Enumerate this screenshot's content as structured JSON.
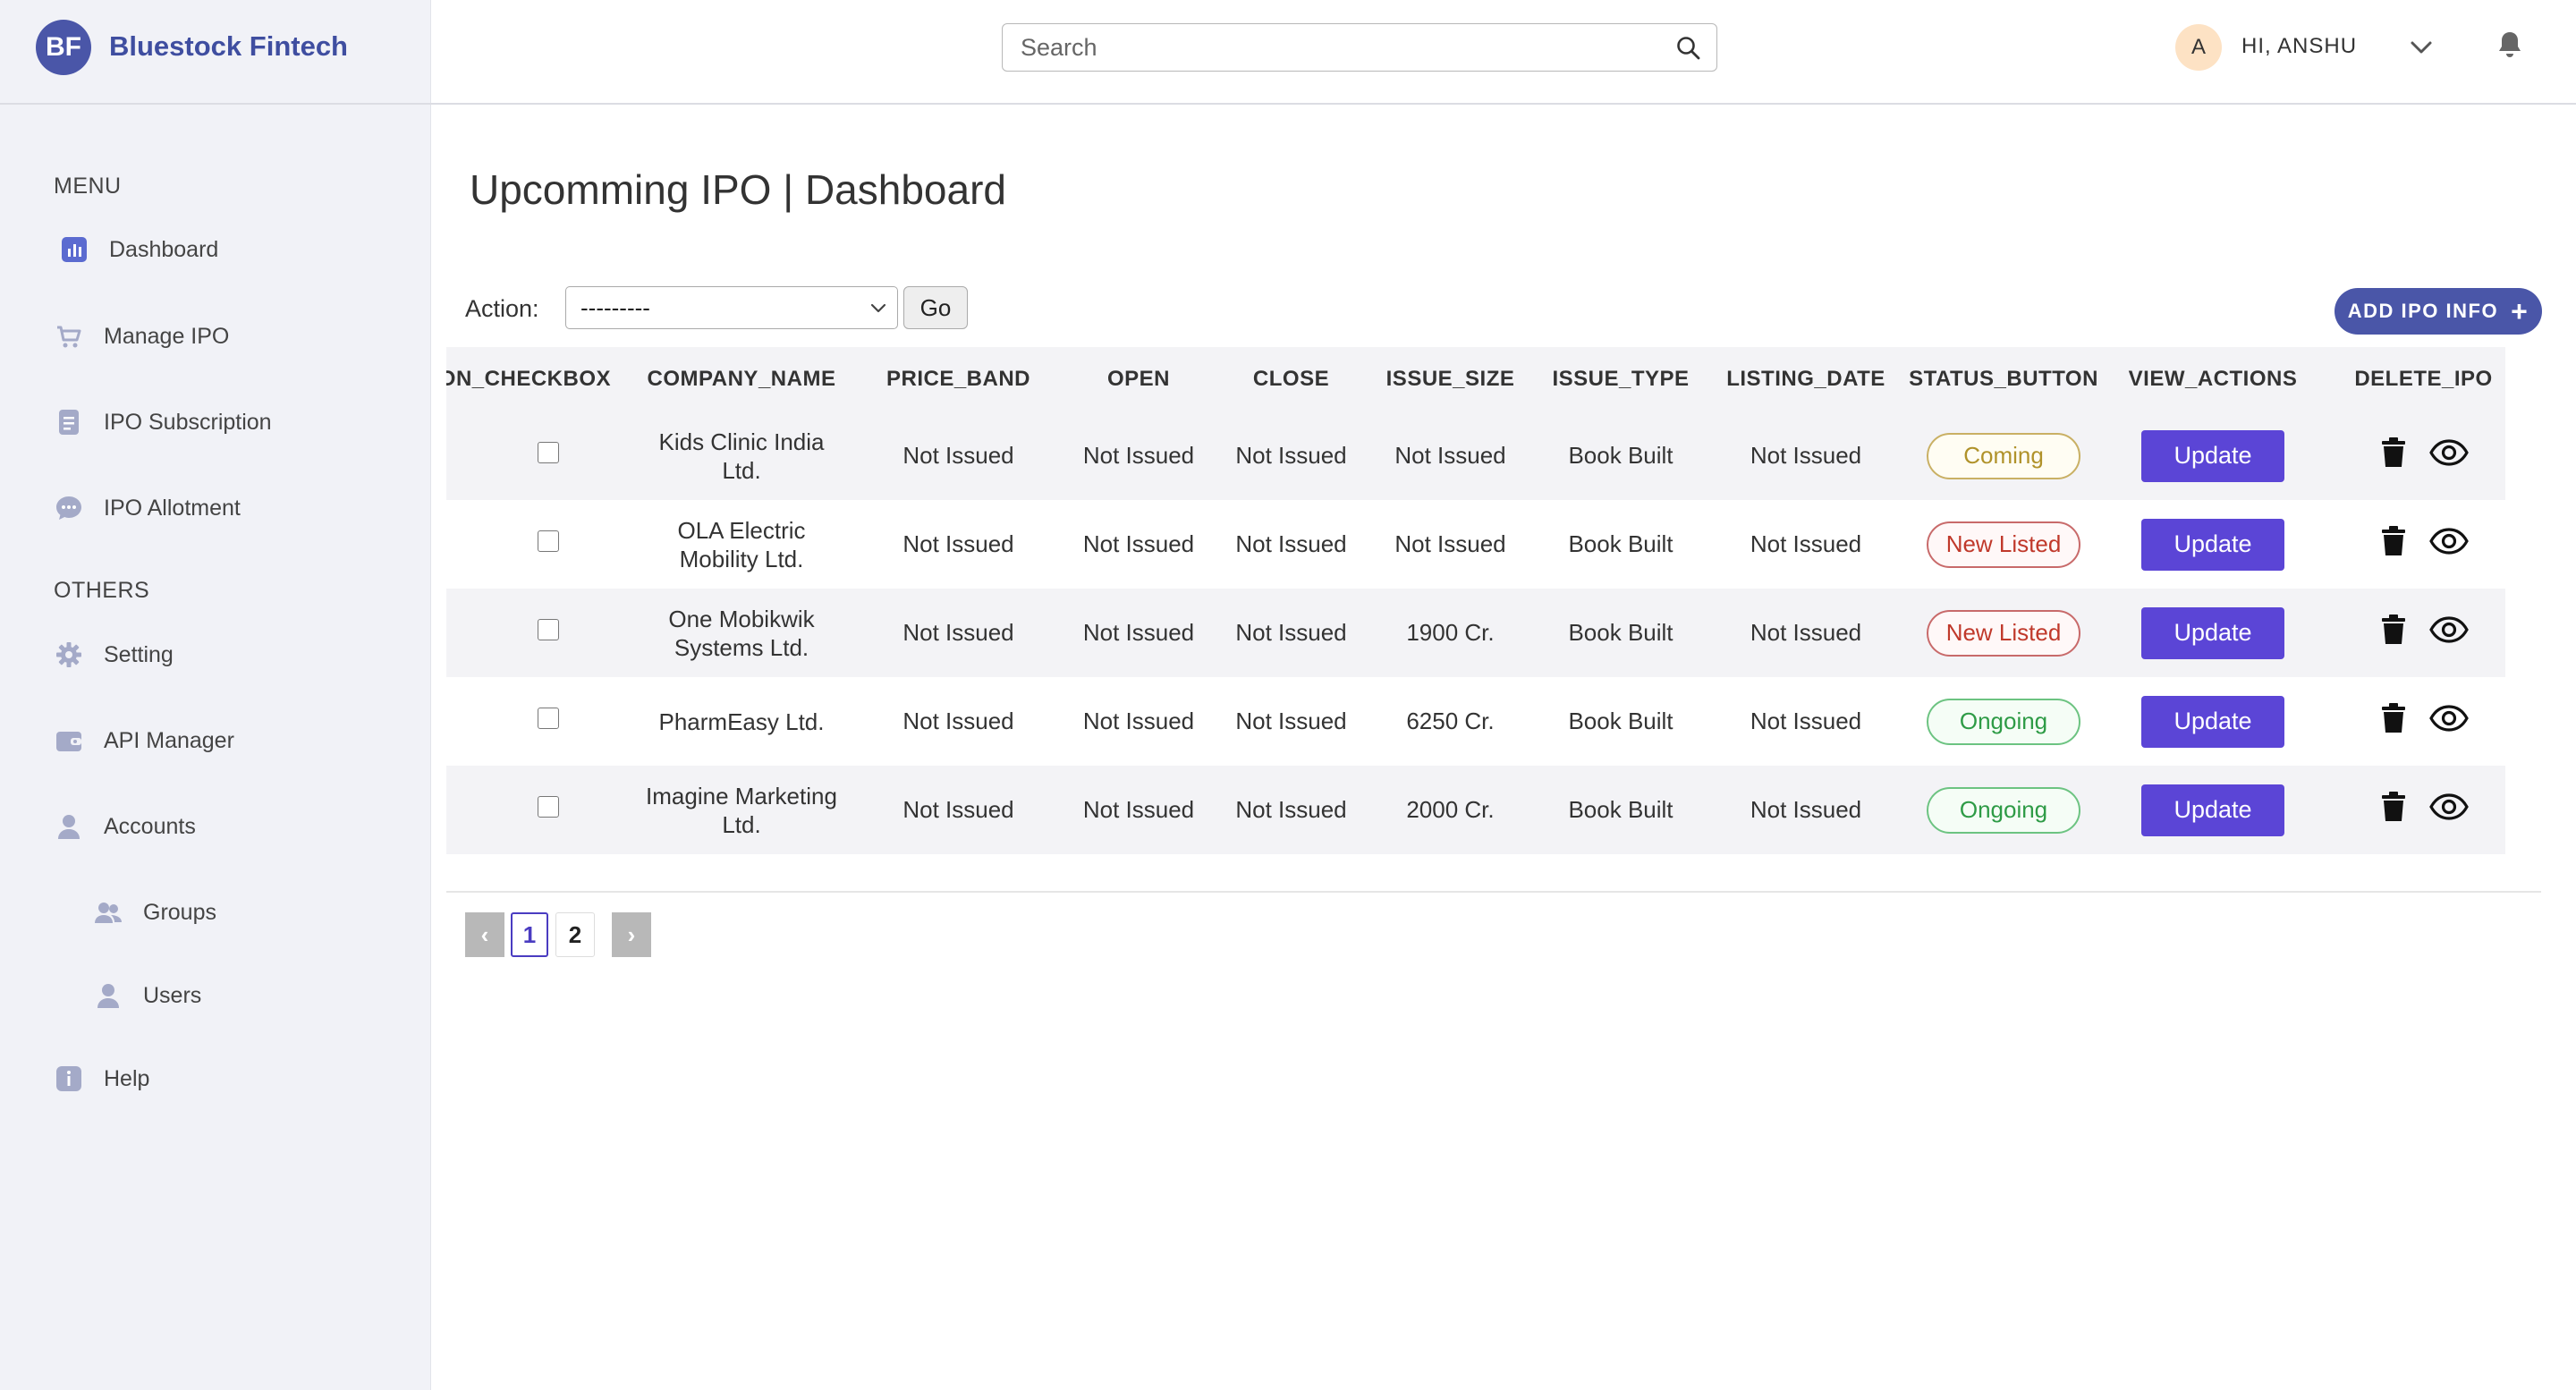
{
  "brand": {
    "logo_text": "BF",
    "name": "Bluestock Fintech"
  },
  "search": {
    "placeholder": "Search"
  },
  "user": {
    "avatar_initial": "A",
    "greeting": "HI, ANSHU"
  },
  "sidebar": {
    "menu_heading": "MENU",
    "others_heading": "OTHERS",
    "items": [
      {
        "label": "Dashboard",
        "icon": "bar-chart-icon"
      },
      {
        "label": "Manage IPO",
        "icon": "cart-icon"
      },
      {
        "label": "IPO Subscription",
        "icon": "document-icon"
      },
      {
        "label": "IPO Allotment",
        "icon": "chat-bubble-icon"
      },
      {
        "label": "Setting",
        "icon": "gear-icon"
      },
      {
        "label": "API Manager",
        "icon": "wallet-icon"
      },
      {
        "label": "Accounts",
        "icon": "user-icon"
      },
      {
        "label": "Groups",
        "icon": "users-icon"
      },
      {
        "label": "Users",
        "icon": "user-icon"
      },
      {
        "label": "Help",
        "icon": "info-icon"
      }
    ]
  },
  "main": {
    "title": "Upcomming IPO | Dashboard",
    "action_label": "Action:",
    "action_selected": "---------",
    "go_label": "Go",
    "add_label": "ADD IPO INFO"
  },
  "table": {
    "columns": [
      "ION_CHECKBOX",
      "COMPANY_NAME",
      "PRICE_BAND",
      "OPEN",
      "CLOSE",
      "ISSUE_SIZE",
      "ISSUE_TYPE",
      "LISTING_DATE",
      "STATUS_BUTTON",
      "VIEW_ACTIONS",
      "DELETE_IPO"
    ],
    "update_label": "Update",
    "rows": [
      {
        "company_line1": "Kids Clinic India",
        "company_line2": "Ltd.",
        "price_band": "Not Issued",
        "open": "Not Issued",
        "close": "Not Issued",
        "issue_size": "Not Issued",
        "issue_type": "Book Built",
        "listing_date": "Not Issued",
        "status": "Coming",
        "status_color": "#b0922a"
      },
      {
        "company_line1": "OLA Electric",
        "company_line2": "Mobility Ltd.",
        "price_band": "Not Issued",
        "open": "Not Issued",
        "close": "Not Issued",
        "issue_size": "Not Issued",
        "issue_type": "Book Built",
        "listing_date": "Not Issued",
        "status": "New Listed",
        "status_color": "#c0392b"
      },
      {
        "company_line1": "One Mobikwik",
        "company_line2": "Systems Ltd.",
        "price_band": "Not Issued",
        "open": "Not Issued",
        "close": "Not Issued",
        "issue_size": "1900 Cr.",
        "issue_type": "Book Built",
        "listing_date": "Not Issued",
        "status": "New Listed",
        "status_color": "#c0392b"
      },
      {
        "company_line1": "PharmEasy Ltd.",
        "company_line2": "",
        "price_band": "Not Issued",
        "open": "Not Issued",
        "close": "Not Issued",
        "issue_size": "6250 Cr.",
        "issue_type": "Book Built",
        "listing_date": "Not Issued",
        "status": "Ongoing",
        "status_color": "#2e9b46"
      },
      {
        "company_line1": "Imagine Marketing",
        "company_line2": "Ltd.",
        "price_band": "Not Issued",
        "open": "Not Issued",
        "close": "Not Issued",
        "issue_size": "2000 Cr.",
        "issue_type": "Book Built",
        "listing_date": "Not Issued",
        "status": "Ongoing",
        "status_color": "#2e9b46"
      }
    ]
  },
  "pagination": {
    "prev": "‹",
    "pages": [
      "1",
      "2"
    ],
    "next": "›",
    "current": "1"
  },
  "colors": {
    "brand": "#4a56a8",
    "update_button": "#5b45d6",
    "sidebar_bg": "#f1f2f7"
  }
}
